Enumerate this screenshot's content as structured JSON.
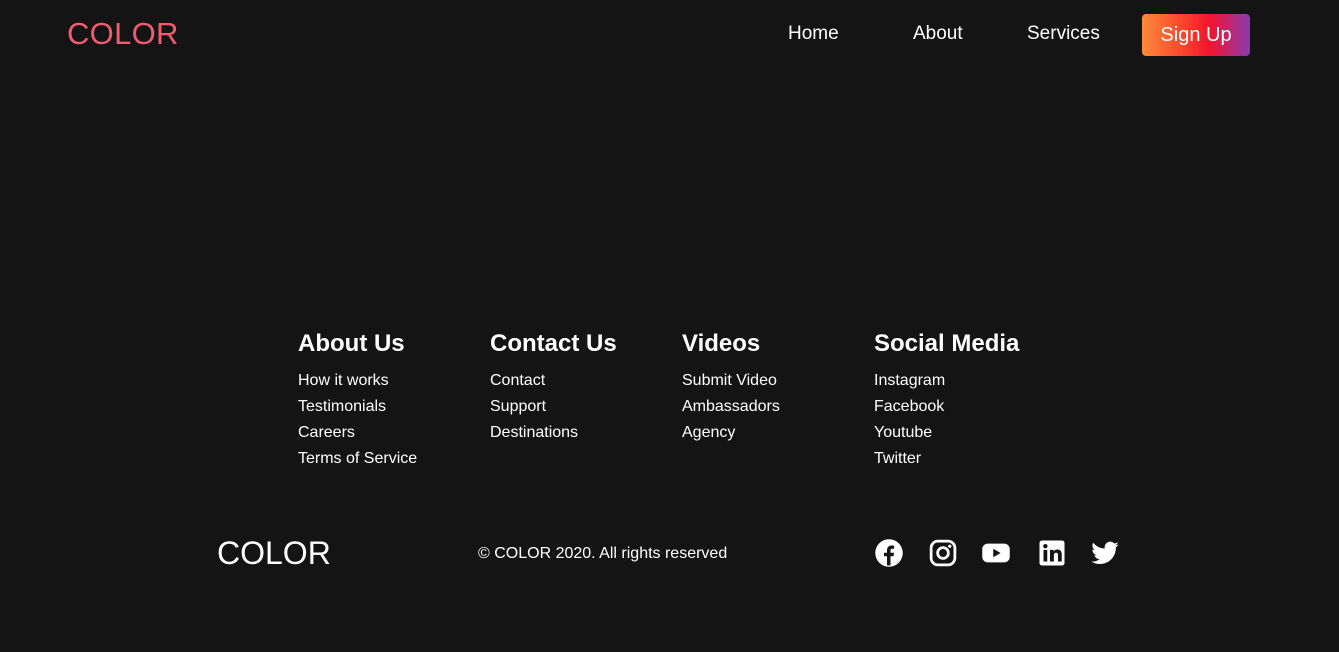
{
  "navbar": {
    "logo": "COLOR",
    "links": [
      {
        "label": "Home"
      },
      {
        "label": "About"
      },
      {
        "label": "Services"
      }
    ],
    "signup_label": "Sign Up",
    "logo_color": "#f15c6c",
    "signup_gradient": [
      "#fd8a3a",
      "#f3142d",
      "#8a3ab0"
    ]
  },
  "footer": {
    "columns": [
      {
        "title": "About Us",
        "links": [
          "How it works",
          "Testimonials",
          "Careers",
          "Terms of Service"
        ]
      },
      {
        "title": "Contact Us",
        "links": [
          "Contact",
          "Support",
          "Destinations"
        ]
      },
      {
        "title": "Videos",
        "links": [
          "Submit Video",
          "Ambassadors",
          "Agency"
        ]
      },
      {
        "title": "Social Media",
        "links": [
          "Instagram",
          "Facebook",
          "Youtube",
          "Twitter"
        ]
      }
    ],
    "logo": "COLOR",
    "copyright": "© COLOR 2020. All rights reserved",
    "social_icons": [
      "facebook-icon",
      "instagram-icon",
      "youtube-icon",
      "linkedin-icon",
      "twitter-icon"
    ]
  },
  "colors": {
    "background": "#141414",
    "text": "#ffffff"
  }
}
